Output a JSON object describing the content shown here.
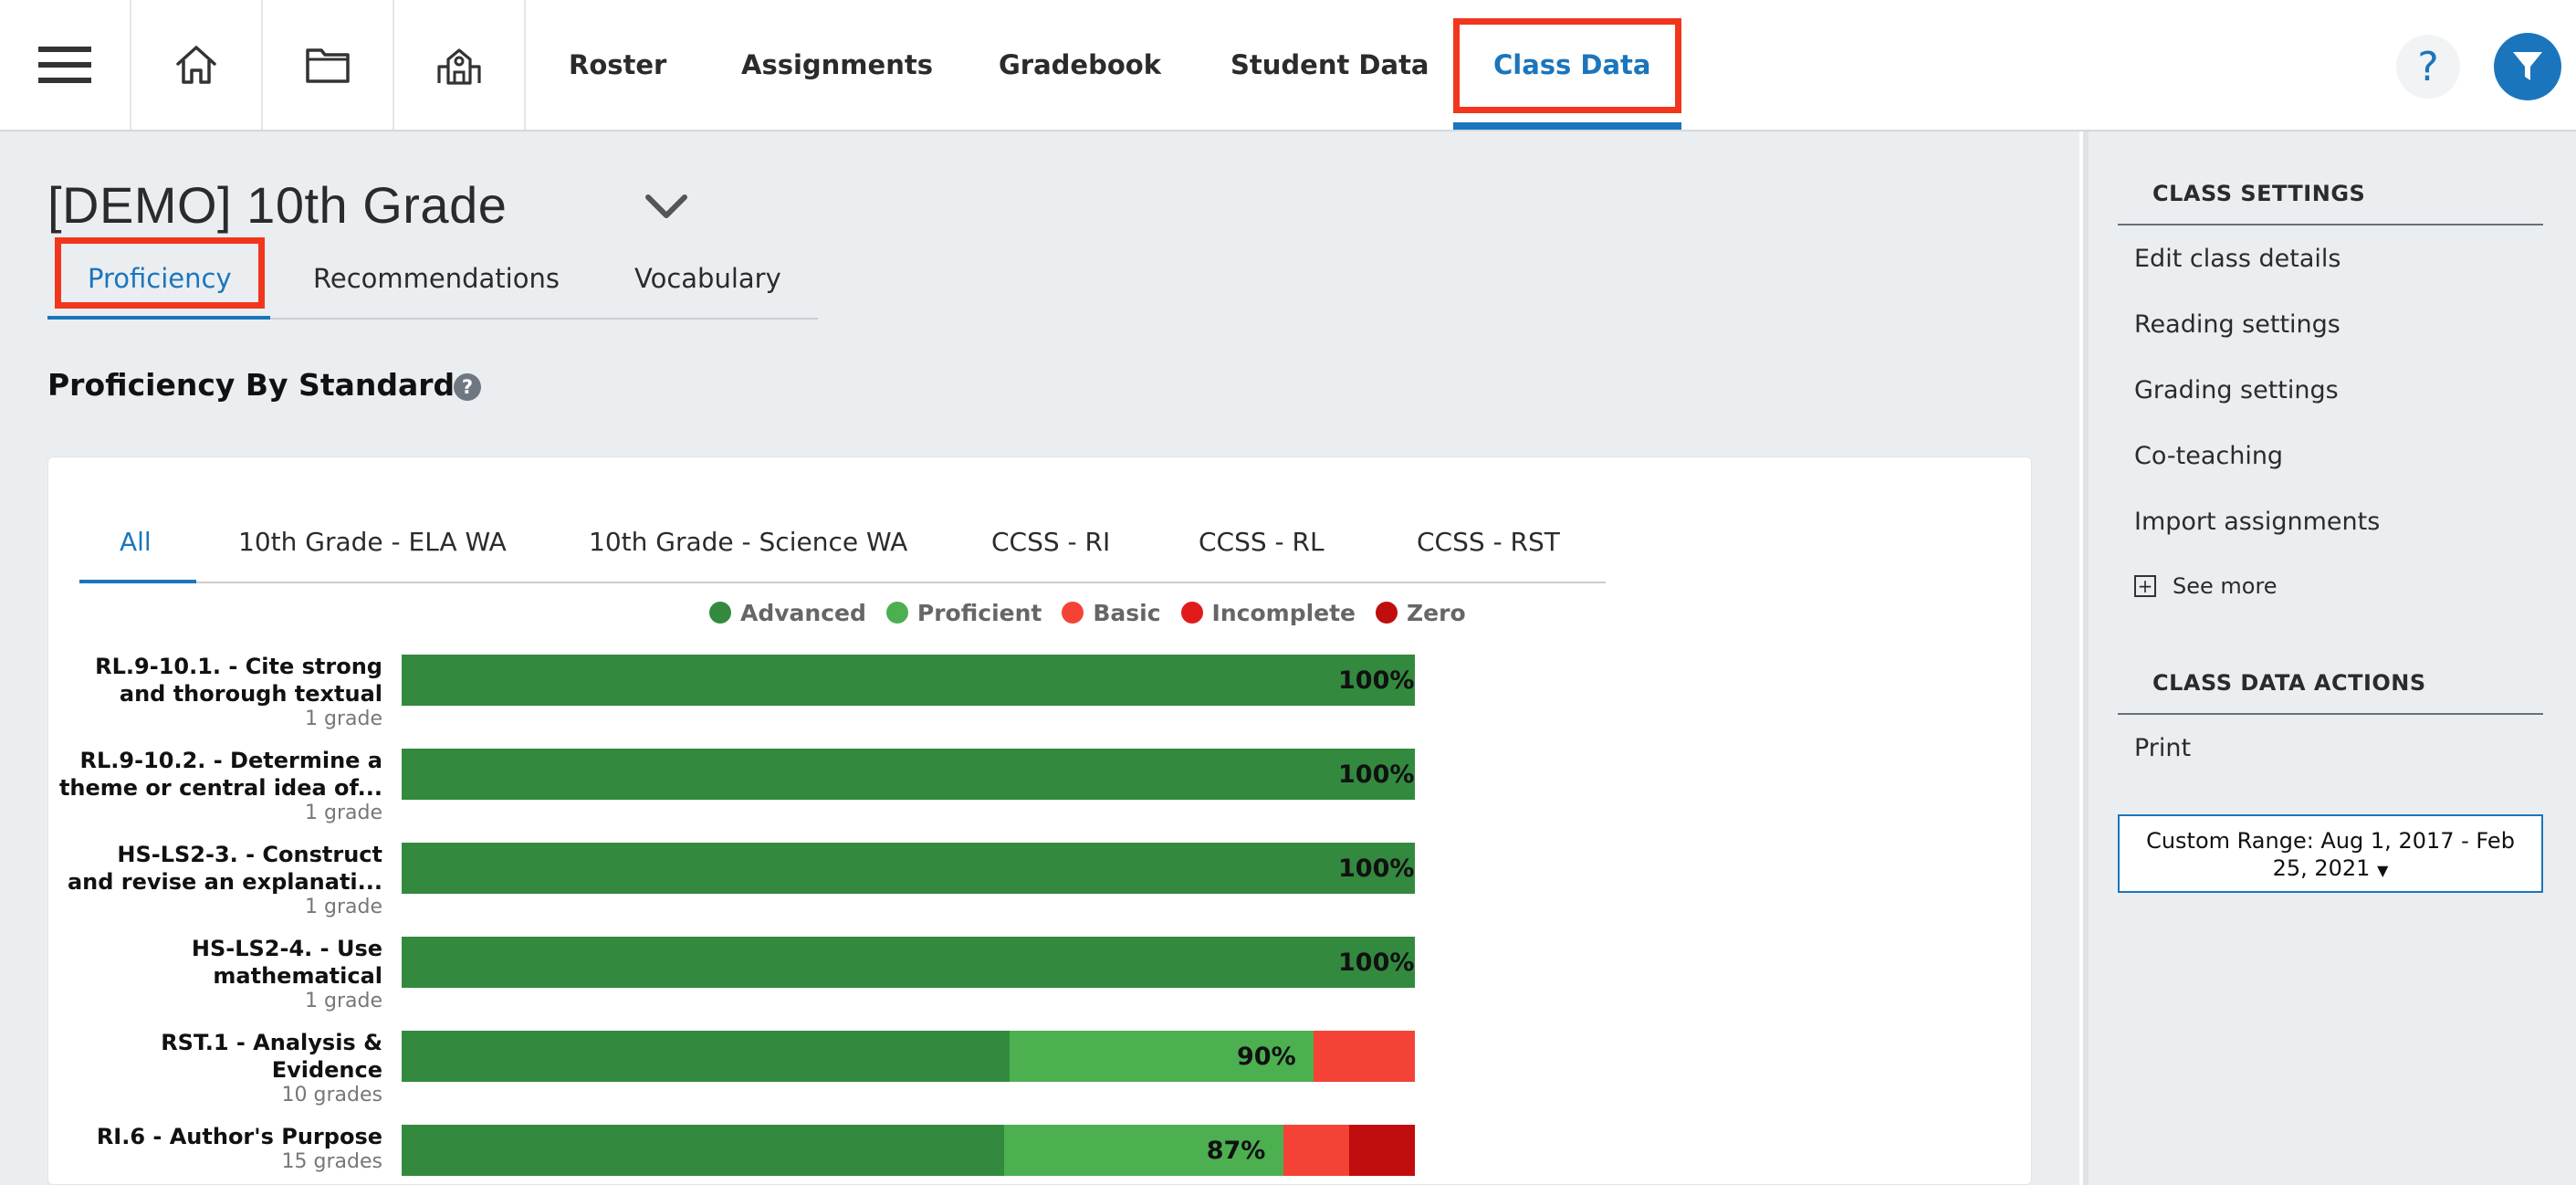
{
  "nav": {
    "icons": [
      "hamburger-icon",
      "home-icon",
      "folder-icon",
      "school-icon"
    ],
    "tabs": [
      {
        "label": "Roster"
      },
      {
        "label": "Assignments"
      },
      {
        "label": "Gradebook"
      },
      {
        "label": "Student Data"
      },
      {
        "label": "Class Data",
        "active": true
      }
    ],
    "help_label": "?"
  },
  "class": {
    "title": "[DEMO] 10th Grade"
  },
  "subtabs": [
    {
      "label": "Proficiency",
      "active": true
    },
    {
      "label": "Recommendations"
    },
    {
      "label": "Vocabulary"
    }
  ],
  "section": {
    "title": "Proficiency By Standard"
  },
  "standard_tabs": [
    {
      "label": "All",
      "active": true
    },
    {
      "label": "10th Grade - ELA WA"
    },
    {
      "label": "10th Grade - Science WA"
    },
    {
      "label": "CCSS - RI"
    },
    {
      "label": "CCSS - RL"
    },
    {
      "label": "CCSS - RST"
    }
  ],
  "colors": {
    "advanced": "#338a3e",
    "proficient": "#4caf50",
    "basic": "#f44336",
    "incomplete": "#e11b1b",
    "zero": "#c00d0d",
    "accent": "#1b75bc",
    "highlight": "#f1361d"
  },
  "chart_data": {
    "type": "bar",
    "orientation": "horizontal",
    "stacked": true,
    "legend": [
      "Advanced",
      "Proficient",
      "Basic",
      "Incomplete",
      "Zero"
    ],
    "legend_placement": "top",
    "xlim": [
      0,
      100
    ],
    "rows": [
      {
        "label_line1": "RL.9-10.1. - Cite strong",
        "label_line2": "and thorough textual",
        "grades": "1 grade",
        "pct_label": "100%",
        "segments": {
          "Advanced": 100,
          "Proficient": 0,
          "Basic": 0,
          "Incomplete": 0,
          "Zero": 0
        }
      },
      {
        "label_line1": "RL.9-10.2. - Determine a",
        "label_line2": "theme or central idea of...",
        "grades": "1 grade",
        "pct_label": "100%",
        "segments": {
          "Advanced": 100,
          "Proficient": 0,
          "Basic": 0,
          "Incomplete": 0,
          "Zero": 0
        }
      },
      {
        "label_line1": "HS-LS2-3. - Construct",
        "label_line2": "and revise an explanati...",
        "grades": "1 grade",
        "pct_label": "100%",
        "segments": {
          "Advanced": 100,
          "Proficient": 0,
          "Basic": 0,
          "Incomplete": 0,
          "Zero": 0
        }
      },
      {
        "label_line1": "HS-LS2-4. - Use",
        "label_line2": "mathematical",
        "grades": "1 grade",
        "pct_label": "100%",
        "segments": {
          "Advanced": 100,
          "Proficient": 0,
          "Basic": 0,
          "Incomplete": 0,
          "Zero": 0
        }
      },
      {
        "label_line1": "RST.1 - Analysis &",
        "label_line2": "Evidence",
        "grades": "10 grades",
        "pct_label": "90%",
        "segments": {
          "Advanced": 60,
          "Proficient": 30,
          "Basic": 10,
          "Incomplete": 0,
          "Zero": 0
        }
      },
      {
        "label_line1": "RI.6 - Author's Purpose",
        "label_line2": "",
        "grades": "15 grades",
        "pct_label": "87%",
        "segments": {
          "Advanced": 59.5,
          "Proficient": 27.5,
          "Basic": 6.5,
          "Incomplete": 0,
          "Zero": 6.5
        }
      }
    ]
  },
  "right_panel": {
    "class_settings_heading": "CLASS SETTINGS",
    "settings_links": [
      "Edit class details",
      "Reading settings",
      "Grading settings",
      "Co-teaching",
      "Import assignments"
    ],
    "see_more_label": "See more",
    "class_data_actions_heading": "CLASS DATA ACTIONS",
    "print_label": "Print",
    "range_line1": "Custom Range: Aug 1, 2017 - Feb",
    "range_line2": "25, 2021"
  }
}
